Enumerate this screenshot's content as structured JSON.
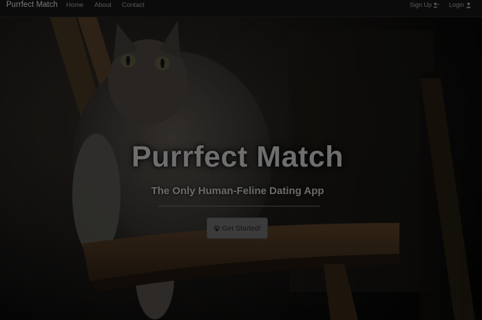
{
  "navbar": {
    "brand": "Purrfect Match",
    "links": [
      {
        "label": "Home"
      },
      {
        "label": "About"
      },
      {
        "label": "Contact"
      }
    ],
    "signup_label": "Sign Up",
    "login_label": "Login"
  },
  "hero": {
    "title": "Purrfect Match",
    "subtitle": "The Only Human-Feline Dating App",
    "cta_label": "Get Started!"
  },
  "icons": {
    "signup": "user-plus-icon",
    "login": "user-icon",
    "cta": "paw-icon"
  },
  "colors": {
    "navbar_bg": "#0b0b0b",
    "button_bg": "#3b3b3b",
    "title_text": "#6e6e6e"
  }
}
